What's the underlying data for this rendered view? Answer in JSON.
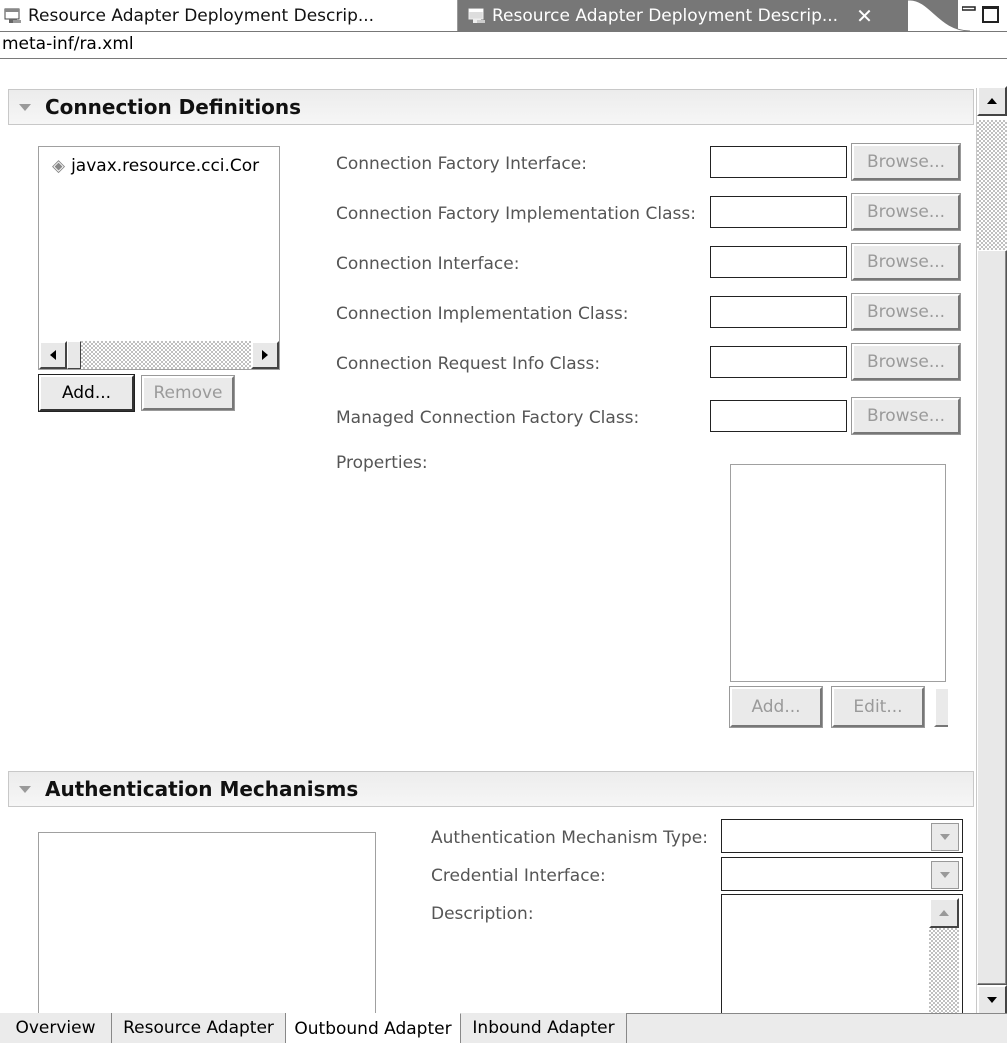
{
  "tabs": [
    {
      "label": "Resource Adapter Deployment Descrip..."
    },
    {
      "label": "Resource Adapter Deployment Descrip...",
      "close": "✕"
    }
  ],
  "path": "meta-inf/ra.xml",
  "connection_definitions": {
    "title": "Connection Definitions",
    "list_items": [
      "javax.resource.cci.Cor"
    ],
    "add_label": "Add...",
    "remove_label": "Remove",
    "fields": [
      {
        "label": "Connection Factory Interface:",
        "value": "",
        "button": "Browse..."
      },
      {
        "label": "Connection Factory Implementation Class:",
        "value": "",
        "button": "Browse..."
      },
      {
        "label": "Connection Interface:",
        "value": "",
        "button": "Browse..."
      },
      {
        "label": "Connection Implementation Class:",
        "value": "",
        "button": "Browse..."
      },
      {
        "label": "Connection Request Info Class:",
        "value": "",
        "button": "Browse..."
      },
      {
        "label": "Managed Connection Factory Class:",
        "value": "",
        "button": "Browse..."
      }
    ],
    "properties_label": "Properties:",
    "properties_add": "Add...",
    "properties_edit": "Edit..."
  },
  "authentication_mechanisms": {
    "title": "Authentication Mechanisms",
    "type_label": "Authentication Mechanism Type:",
    "type_value": "",
    "credential_label": "Credential Interface:",
    "credential_value": "",
    "description_label": "Description:",
    "description_value": ""
  },
  "page_tabs": [
    {
      "label": "Overview",
      "active": false
    },
    {
      "label": "Resource Adapter",
      "active": false
    },
    {
      "label": "Outbound Adapter",
      "active": true
    },
    {
      "label": "Inbound Adapter",
      "active": false
    }
  ],
  "colors": {
    "active_tab_bg": "#777777",
    "section_header_bg": "#ececec",
    "disabled_text": "#9a9a9a"
  }
}
